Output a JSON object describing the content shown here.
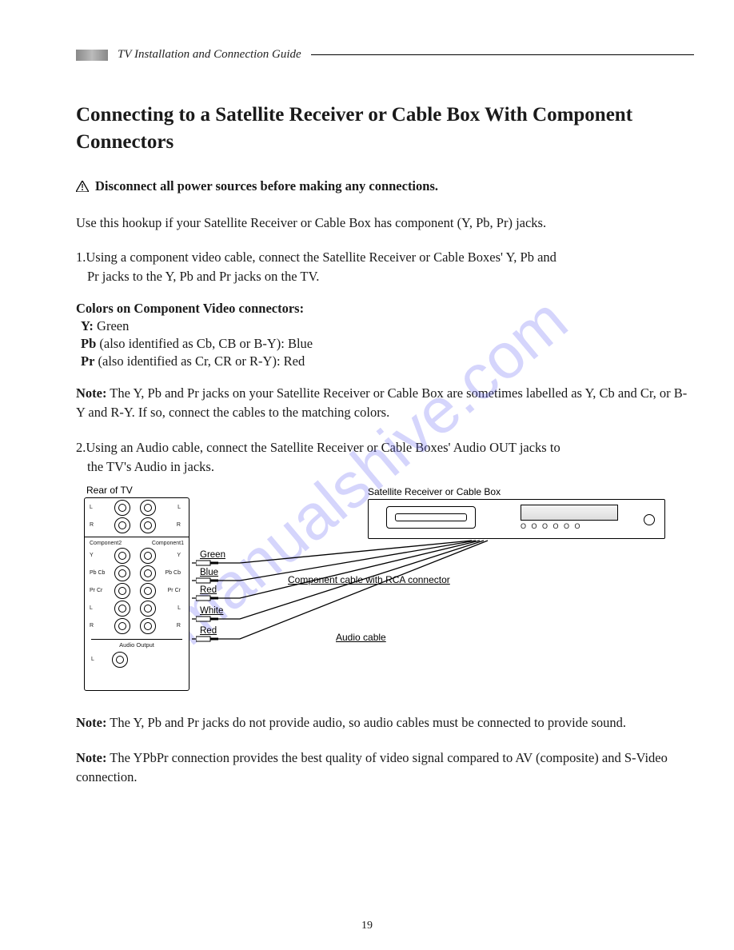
{
  "header": {
    "doc_title": "TV Installation and Connection Guide"
  },
  "title": "Connecting to a Satellite Receiver or Cable Box With Component Connectors",
  "warning": "Disconnect all power sources before making any connections.",
  "intro": "Use this hookup if your Satellite Receiver or Cable Box  has component (Y, Pb, Pr) jacks.",
  "step1_a": "1.Using a component video cable, connect the Satellite Receiver or Cable Boxes' Y, Pb and",
  "step1_b": "Pr jacks to the Y, Pb and Pr jacks on the TV.",
  "colors_head": "Colors on Component Video connectors:",
  "colors": {
    "y_label": "Y:",
    "y_val": " Green",
    "pb_label": "Pb",
    "pb_val": " (also identified as Cb, CB or B-Y): Blue",
    "pr_label": "Pr",
    "pr_val": " (also identified as Cr, CR or R-Y): Red"
  },
  "note1_label": "Note:",
  "note1_text": " The Y, Pb and Pr jacks on your Satellite Receiver or Cable Box  are sometimes labelled as Y, Cb and Cr, or B-Y and R-Y.  If so, connect the cables to the matching colors.",
  "step2_a": "2.Using an Audio cable, connect the Satellite Receiver or Cable Boxes' Audio OUT jacks to",
  "step2_b": "the TV's Audio in jacks.",
  "fig": {
    "rear_tv": "Rear of TV",
    "sat_box": "Satellite Receiver or Cable Box",
    "comp2": "Component2",
    "comp1": "Component1",
    "y": "Y",
    "pbcb": "Pb Cb",
    "prcr": "Pr Cr",
    "l": "L",
    "r": "R",
    "audio_out": "Audio Output",
    "green": "Green",
    "blue": "Blue",
    "red": "Red",
    "white": "White",
    "red2": "Red",
    "comp_cable": "Component cable with RCA connector",
    "audio_cable": "Audio cable",
    "leds": "O O O   O O O"
  },
  "note2_label": "Note:",
  "note2_text": " The Y, Pb and Pr jacks do not provide audio, so audio cables must be connected to provide sound.",
  "note3_label": "Note:",
  "note3_text": " The YPbPr connection provides the best quality of video signal compared to AV (composite) and S-Video connection.",
  "watermark": "manualshive.com",
  "page_number": "19"
}
